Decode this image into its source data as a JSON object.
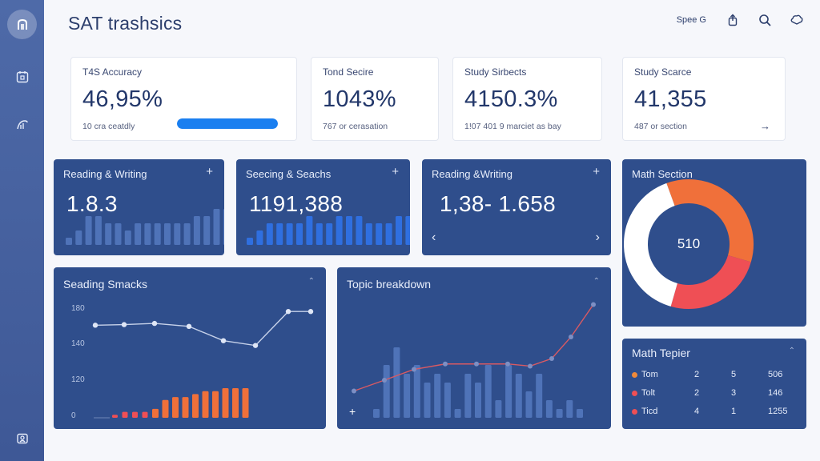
{
  "app": {
    "title": "SAT trashsics"
  },
  "topbar": {
    "speed_label": "Spee G"
  },
  "sidebar": {
    "items": [
      {
        "icon": "home-icon"
      },
      {
        "icon": "calendar-icon"
      },
      {
        "icon": "chart-icon"
      },
      {
        "icon": "profile-icon"
      }
    ]
  },
  "stats": [
    {
      "label": "T4S Accuracy",
      "value": "46,95%",
      "sub": "10 cra ceatdly",
      "progress": 1.0
    },
    {
      "label": "Tond Secire",
      "value": "1043%",
      "sub": "767 or cerasation"
    },
    {
      "label": "Study Sirbects",
      "value": "4150.3%",
      "sub": "1!07 401 9 marciet as bay"
    },
    {
      "label": "Study Scarce",
      "value": "41,355",
      "sub": "487 or section"
    }
  ],
  "cards": {
    "reading1": {
      "title": "Reading & Writing",
      "value": "1.8.3"
    },
    "seeing": {
      "title": "Seecing & Seachs",
      "value": "1191,388"
    },
    "reading2": {
      "title": "Reading &Writing",
      "value": "1,38- 1.658"
    },
    "math_section": {
      "title": "Math Section",
      "value": "510"
    },
    "seading": {
      "title": "Seading Smacks",
      "yticks": [
        "180",
        "140",
        "120",
        "0"
      ]
    },
    "topic": {
      "title": "Topic breakdown"
    },
    "math_tepler": {
      "title": "Math Tepier",
      "rows": [
        {
          "name": "Tom",
          "a": "2",
          "b": "5",
          "c": "506",
          "color": "#f08a3a"
        },
        {
          "name": "Tolt",
          "a": "2",
          "b": "3",
          "c": "146",
          "color": "#ef4f55"
        },
        {
          "name": "Ticd",
          "a": "4",
          "b": "1",
          "c": "1255",
          "color": "#ef4f55"
        }
      ]
    }
  },
  "colors": {
    "card": "#2f4e8c",
    "bar_muted": "#4f73b8",
    "bar_bright": "#2f6fe0",
    "orange": "#f0703a",
    "red": "#ef4f55",
    "line": "#c7d2ea",
    "accent_blue": "#1a7ff0"
  },
  "chart_data": [
    {
      "type": "bar",
      "title": "Reading & Writing",
      "values": [
        1,
        2,
        4,
        4,
        3,
        3,
        2,
        3,
        3,
        3,
        3,
        3,
        3,
        4,
        4,
        5,
        5
      ]
    },
    {
      "type": "bar",
      "title": "Seecing & Seachs",
      "values": [
        1,
        2,
        3,
        3,
        3,
        3,
        4,
        3,
        3,
        4,
        4,
        4,
        3,
        3,
        3,
        4,
        4
      ]
    },
    {
      "type": "pie",
      "title": "Math Section",
      "center_label": "510",
      "slices": [
        {
          "value": 35,
          "color": "#f0703a"
        },
        {
          "value": 25,
          "color": "#ef4f55"
        },
        {
          "value": 40,
          "color": "#ffffff"
        }
      ]
    },
    {
      "type": "line",
      "title": "Seading Smacks",
      "ylim": [
        0,
        180
      ],
      "ytick_labels": [
        "180",
        "140",
        "120",
        "0"
      ],
      "series": [
        {
          "values": [
            150,
            151,
            153,
            148,
            124,
            116,
            173,
            173
          ]
        }
      ],
      "bars": [
        1,
        2,
        2,
        2,
        3,
        6,
        7,
        7,
        8,
        9,
        9,
        10,
        10,
        10
      ]
    },
    {
      "type": "bar",
      "title": "Topic breakdown",
      "values": [
        1,
        6,
        8,
        5,
        6,
        4,
        5,
        4,
        1,
        5,
        4,
        6,
        2,
        6,
        5,
        3,
        5,
        2,
        1,
        2,
        1
      ],
      "series": [
        {
          "values": [
            1,
            2,
            3,
            3.5,
            3.5,
            3.5,
            3.3,
            4,
            6,
            9
          ]
        }
      ]
    }
  ]
}
